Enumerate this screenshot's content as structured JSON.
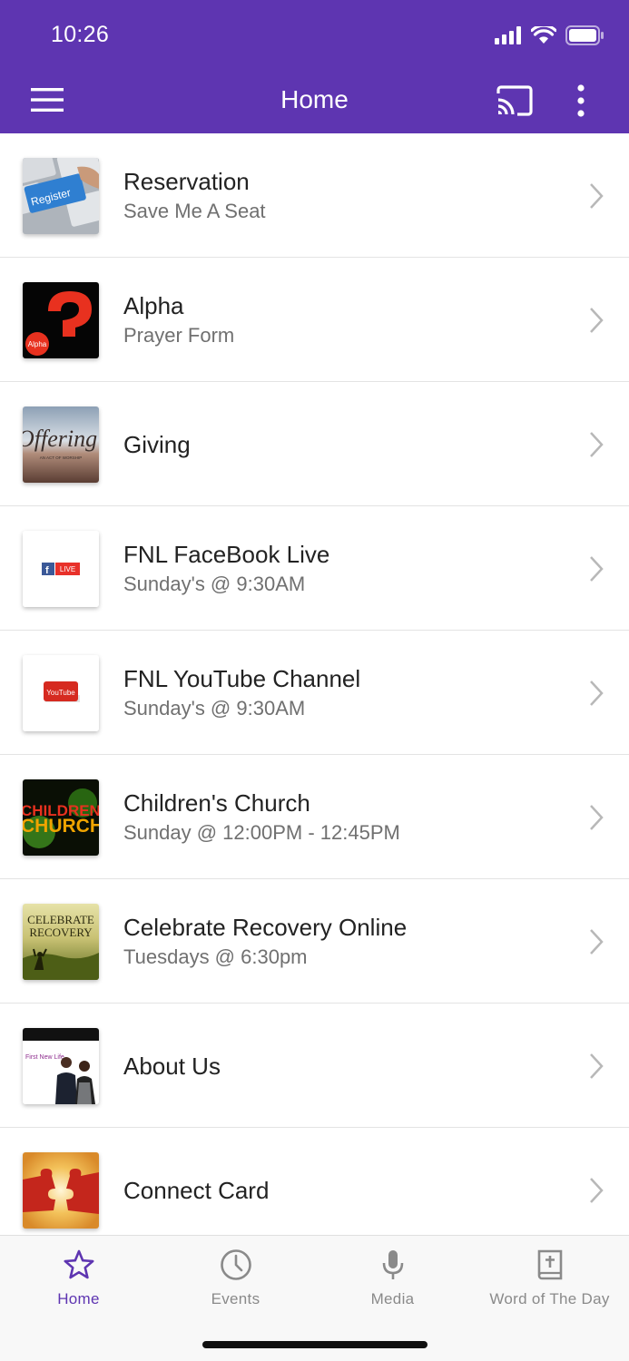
{
  "status_bar": {
    "time": "10:26"
  },
  "header": {
    "title": "Home"
  },
  "colors": {
    "header_bg": "#5e35b1",
    "tab_active": "#5e35b1",
    "tab_inactive": "#8a8a8a"
  },
  "items": [
    {
      "title": "Reservation",
      "subtitle": "Save Me A Seat",
      "thumb_text": "Register"
    },
    {
      "title": "Alpha",
      "subtitle": "Prayer Form",
      "thumb_text": "Alpha"
    },
    {
      "title": "Giving",
      "subtitle": "",
      "thumb_text": "Offering",
      "thumb_subtext": "AN ACT OF WORSHIP"
    },
    {
      "title": "FNL FaceBook Live",
      "subtitle": "Sunday's @ 9:30AM",
      "thumb_text": "LIVE"
    },
    {
      "title": "FNL YouTube Channel",
      "subtitle": "Sunday's @ 9:30AM",
      "thumb_text": "YouTube"
    },
    {
      "title": "Children's Church",
      "subtitle": "Sunday @ 12:00PM - 12:45PM",
      "thumb_text": "CHILDRENS",
      "thumb_subtext": "CHURCH"
    },
    {
      "title": "Celebrate Recovery Online",
      "subtitle": "Tuesdays @ 6:30pm",
      "thumb_text": "CELEBRATE",
      "thumb_subtext": "RECOVERY"
    },
    {
      "title": "About Us",
      "subtitle": "",
      "thumb_text": "First New Life"
    },
    {
      "title": "Connect Card",
      "subtitle": "",
      "thumb_text": ""
    }
  ],
  "tabs": [
    {
      "label": "Home",
      "icon": "star-icon",
      "active": true
    },
    {
      "label": "Events",
      "icon": "clock-icon",
      "active": false
    },
    {
      "label": "Media",
      "icon": "microphone-icon",
      "active": false
    },
    {
      "label": "Word of The Day",
      "icon": "bible-icon",
      "active": false
    }
  ]
}
